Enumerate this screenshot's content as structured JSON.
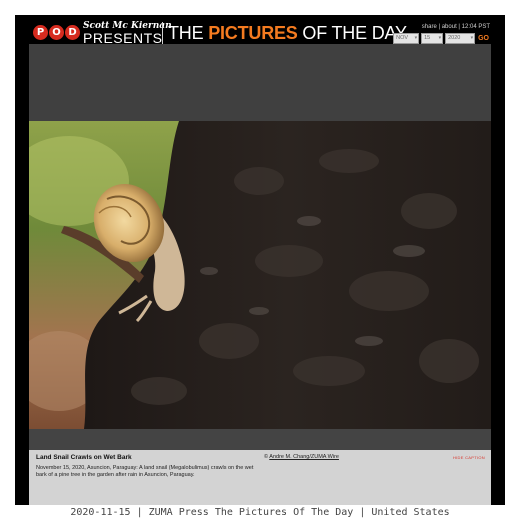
{
  "header": {
    "logo_letters": [
      "P",
      "O",
      "D"
    ],
    "brand_name": "Scott Mc Kiernan",
    "brand_presents": "PRESENTS",
    "title_pre": "THE ",
    "title_highlight": "PICTURES",
    "title_post": " OF THE DAY",
    "links": {
      "share": "share",
      "about": "about",
      "time": "12:04 PST",
      "sep": " | "
    },
    "date_select": {
      "month": "NOV",
      "day": "15",
      "year": "2020"
    },
    "go_label": "GO",
    "accent_color": "#f47b20",
    "logo_color": "#d62b1f"
  },
  "caption": {
    "title": "Land Snail Crawls on Wet Bark",
    "text": "November 15, 2020, Asuncion, Paraguay: A land snail (Megalobulimus) crawls on the wet bark of a pine tree in the garden after rain in Asuncion, Paraguay.",
    "credit_prefix": "© ",
    "credit_link": "Andre M. Chang/ZUMA Wire",
    "hide_label": "HIDE CAPTION"
  },
  "footer": {
    "text": "2020-11-15 | ZUMA Press The Pictures Of The Day | United States"
  }
}
